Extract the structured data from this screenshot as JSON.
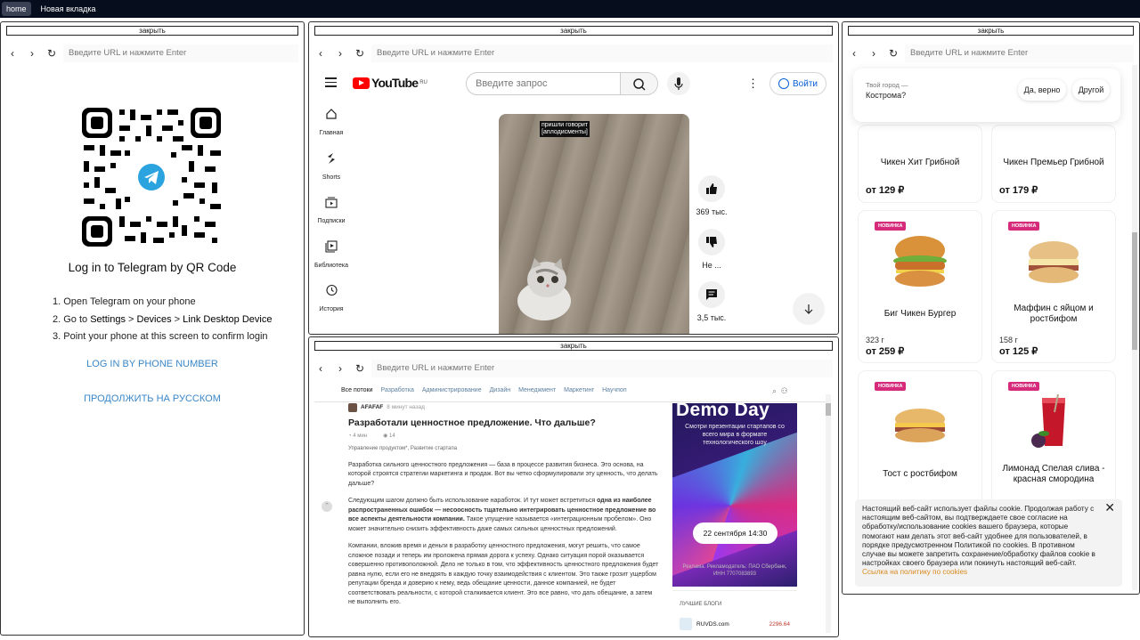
{
  "topbar": {
    "tabs": [
      "home",
      "Новая вкладка"
    ]
  },
  "common": {
    "close_label": "закрыть",
    "url_placeholder": "Введите URL и нажмите Enter"
  },
  "telegram": {
    "title": "Log in to Telegram by QR Code",
    "step1": "Open Telegram on your phone",
    "step2_prefix": "Go to ",
    "step2_settings": "Settings",
    "step2_devices": "Devices",
    "step2_link": "Link Desktop Device",
    "step3": "Point your phone at this screen to confirm login",
    "phone_link": "LOG IN BY PHONE NUMBER",
    "russian_link": "ПРОДОЛЖИТЬ НА РУССКОМ"
  },
  "youtube": {
    "logo": "YouTube",
    "region": "RU",
    "search_placeholder": "Введите запрос",
    "signin": "Войти",
    "sidebar": [
      "Главная",
      "Shorts",
      "Подписки",
      "Библиотека",
      "История"
    ],
    "caption_line1": "пришли говорит",
    "caption_line2": "[аплодисменты]",
    "likes": "369 тыс.",
    "dislike": "Не ...",
    "comments": "3,5 тыс."
  },
  "habr": {
    "nav": [
      "Все потоки",
      "Разработка",
      "Администрирование",
      "Дизайн",
      "Менеджмент",
      "Маркетинг",
      "Научпоп"
    ],
    "author": "AFAFAF",
    "time": "8 минут назад",
    "title": "Разработали ценностное предложение. Что дальше?",
    "read_time": "4 мин",
    "views": "14",
    "hubs": "Управление продуктом*, Развитие стартапа",
    "p1": "Разработка сильного ценностного предложения — база в процессе развития бизнеса. Это основа, на которой строятся стратегии маркетинга и продаж. Вот вы четко сформулировали эту ценность, что делать дальше?",
    "p2a": "Следующим шагом должно быть использование наработок. И тут может встретиться ",
    "p2b": "одна из наиболее распространенных ошибок —  несоосность тщательно интегрировать ценностное предложение во все аспекты деятельности компании.",
    "p2c": " Такое упущение называется «интеграционным пробелом». Оно может значительно снизить эффективность даже самых сильных ценностных предложений.",
    "p3": "Компании, вложив время и деньги в разработку ценностного предложения, могут решить, что самое сложное позади и теперь им проложена прямая дорога к успеху. Однако ситуация порой оказывается совершенно противоположной. Дело не только в том, что эффективность ценностного предложения будет равна нулю, если его не внедрять в каждую точку взаимодействия с клиентом. Это также грозит ущербом репутации бренда и доверию к нему, ведь обещание ценности, данное компанией, не будет соответствовать реальности, с которой сталкивается клиент. Это все равно, что дать обещание, а затем не выполнить его.",
    "banner_title": "Demo Day",
    "banner_sub": "Смотри презентации стартапов со всего мира в формате технологического шоу",
    "banner_date": "22 сентября 14:30",
    "banner_adv": "Реклама. Рекламодатель: ПАО Сбербанк, ИНН 7707083893",
    "blogs_heading": "ЛУЧШИЕ БЛОГИ",
    "blog_name": "RUVDS.com",
    "blog_score": "2296.64"
  },
  "food": {
    "city_q": "Твой город —",
    "city": "Кострома?",
    "yes": "Да, верно",
    "other": "Другой",
    "badge": "НОВИНКА",
    "items": [
      {
        "name": "Чикен Хит Грибной",
        "price": "от 129 ₽"
      },
      {
        "name": "Чикен Премьер Грибной",
        "price": "от 179 ₽"
      },
      {
        "name": "Биг Чикен Бургер",
        "weight": "323 г",
        "price": "от 259 ₽"
      },
      {
        "name": "Маффин с яйцом и ростбифом",
        "weight": "158 г",
        "price": "от 125 ₽"
      },
      {
        "name": "Тост с ростбифом"
      },
      {
        "name": "Лимонад Спелая слива - красная смородина"
      }
    ],
    "cookie_text": "Настоящий веб-сайт использует файлы cookie. Продолжая работу с настоящим веб-сайтом, вы подтверждаете свое согласие на обработку/использование cookies вашего браузера, которые помогают нам делать этот веб-сайт удобнее для пользователей, в порядке предусмотренном Политикой по cookies. В противном случае вы можете запретить сохранение/обработку файлов cookie в настройках своего браузера или покинуть настоящий веб-сайт.",
    "cookie_link": "Ссылка на политику по cookies"
  }
}
